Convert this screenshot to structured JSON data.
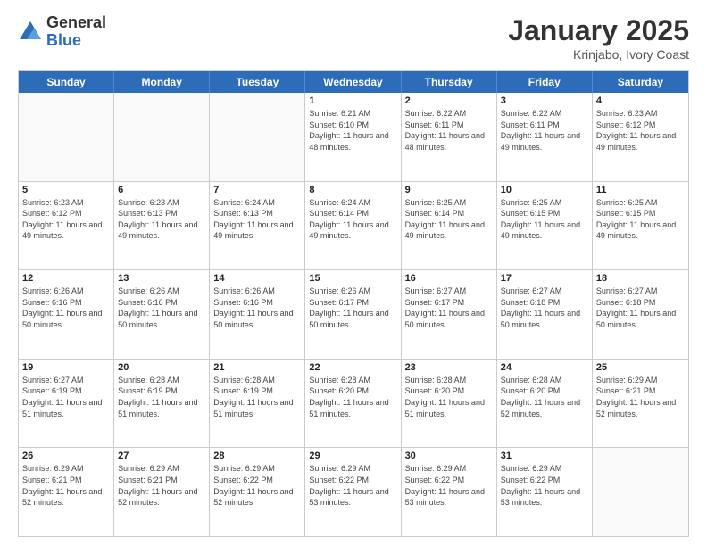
{
  "logo": {
    "general": "General",
    "blue": "Blue"
  },
  "header": {
    "month": "January 2025",
    "location": "Krinjabo, Ivory Coast"
  },
  "days_of_week": [
    "Sunday",
    "Monday",
    "Tuesday",
    "Wednesday",
    "Thursday",
    "Friday",
    "Saturday"
  ],
  "weeks": [
    [
      {
        "day": "",
        "empty": true
      },
      {
        "day": "",
        "empty": true
      },
      {
        "day": "",
        "empty": true
      },
      {
        "day": "1",
        "sunrise": "6:21 AM",
        "sunset": "6:10 PM",
        "daylight": "11 hours and 48 minutes."
      },
      {
        "day": "2",
        "sunrise": "6:22 AM",
        "sunset": "6:11 PM",
        "daylight": "11 hours and 48 minutes."
      },
      {
        "day": "3",
        "sunrise": "6:22 AM",
        "sunset": "6:11 PM",
        "daylight": "11 hours and 49 minutes."
      },
      {
        "day": "4",
        "sunrise": "6:23 AM",
        "sunset": "6:12 PM",
        "daylight": "11 hours and 49 minutes."
      }
    ],
    [
      {
        "day": "5",
        "sunrise": "6:23 AM",
        "sunset": "6:12 PM",
        "daylight": "11 hours and 49 minutes."
      },
      {
        "day": "6",
        "sunrise": "6:23 AM",
        "sunset": "6:13 PM",
        "daylight": "11 hours and 49 minutes."
      },
      {
        "day": "7",
        "sunrise": "6:24 AM",
        "sunset": "6:13 PM",
        "daylight": "11 hours and 49 minutes."
      },
      {
        "day": "8",
        "sunrise": "6:24 AM",
        "sunset": "6:14 PM",
        "daylight": "11 hours and 49 minutes."
      },
      {
        "day": "9",
        "sunrise": "6:25 AM",
        "sunset": "6:14 PM",
        "daylight": "11 hours and 49 minutes."
      },
      {
        "day": "10",
        "sunrise": "6:25 AM",
        "sunset": "6:15 PM",
        "daylight": "11 hours and 49 minutes."
      },
      {
        "day": "11",
        "sunrise": "6:25 AM",
        "sunset": "6:15 PM",
        "daylight": "11 hours and 49 minutes."
      }
    ],
    [
      {
        "day": "12",
        "sunrise": "6:26 AM",
        "sunset": "6:16 PM",
        "daylight": "11 hours and 50 minutes."
      },
      {
        "day": "13",
        "sunrise": "6:26 AM",
        "sunset": "6:16 PM",
        "daylight": "11 hours and 50 minutes."
      },
      {
        "day": "14",
        "sunrise": "6:26 AM",
        "sunset": "6:16 PM",
        "daylight": "11 hours and 50 minutes."
      },
      {
        "day": "15",
        "sunrise": "6:26 AM",
        "sunset": "6:17 PM",
        "daylight": "11 hours and 50 minutes."
      },
      {
        "day": "16",
        "sunrise": "6:27 AM",
        "sunset": "6:17 PM",
        "daylight": "11 hours and 50 minutes."
      },
      {
        "day": "17",
        "sunrise": "6:27 AM",
        "sunset": "6:18 PM",
        "daylight": "11 hours and 50 minutes."
      },
      {
        "day": "18",
        "sunrise": "6:27 AM",
        "sunset": "6:18 PM",
        "daylight": "11 hours and 50 minutes."
      }
    ],
    [
      {
        "day": "19",
        "sunrise": "6:27 AM",
        "sunset": "6:19 PM",
        "daylight": "11 hours and 51 minutes."
      },
      {
        "day": "20",
        "sunrise": "6:28 AM",
        "sunset": "6:19 PM",
        "daylight": "11 hours and 51 minutes."
      },
      {
        "day": "21",
        "sunrise": "6:28 AM",
        "sunset": "6:19 PM",
        "daylight": "11 hours and 51 minutes."
      },
      {
        "day": "22",
        "sunrise": "6:28 AM",
        "sunset": "6:20 PM",
        "daylight": "11 hours and 51 minutes."
      },
      {
        "day": "23",
        "sunrise": "6:28 AM",
        "sunset": "6:20 PM",
        "daylight": "11 hours and 51 minutes."
      },
      {
        "day": "24",
        "sunrise": "6:28 AM",
        "sunset": "6:20 PM",
        "daylight": "11 hours and 52 minutes."
      },
      {
        "day": "25",
        "sunrise": "6:29 AM",
        "sunset": "6:21 PM",
        "daylight": "11 hours and 52 minutes."
      }
    ],
    [
      {
        "day": "26",
        "sunrise": "6:29 AM",
        "sunset": "6:21 PM",
        "daylight": "11 hours and 52 minutes."
      },
      {
        "day": "27",
        "sunrise": "6:29 AM",
        "sunset": "6:21 PM",
        "daylight": "11 hours and 52 minutes."
      },
      {
        "day": "28",
        "sunrise": "6:29 AM",
        "sunset": "6:22 PM",
        "daylight": "11 hours and 52 minutes."
      },
      {
        "day": "29",
        "sunrise": "6:29 AM",
        "sunset": "6:22 PM",
        "daylight": "11 hours and 53 minutes."
      },
      {
        "day": "30",
        "sunrise": "6:29 AM",
        "sunset": "6:22 PM",
        "daylight": "11 hours and 53 minutes."
      },
      {
        "day": "31",
        "sunrise": "6:29 AM",
        "sunset": "6:22 PM",
        "daylight": "11 hours and 53 minutes."
      },
      {
        "day": "",
        "empty": true
      }
    ]
  ]
}
